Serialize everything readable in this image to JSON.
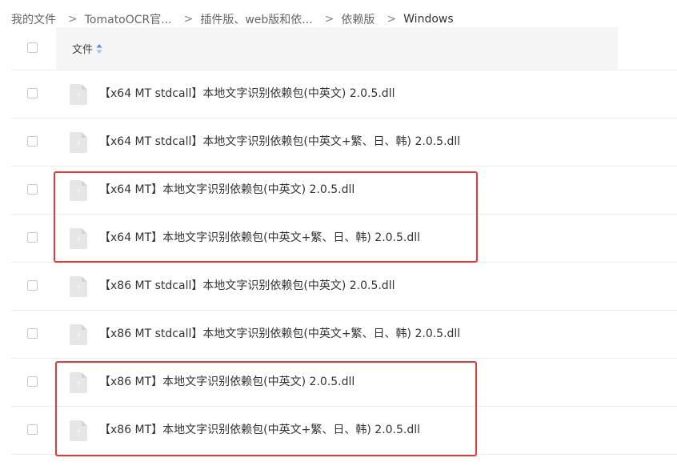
{
  "breadcrumb": {
    "items": [
      "我的文件",
      "TomatoOCR官...",
      "插件版、web版和依...",
      "依赖版",
      "Windows"
    ],
    "separator": ">"
  },
  "table": {
    "header_label": "文件",
    "files": [
      "【x64 MT stdcall】本地文字识别依赖包(中英文) 2.0.5.dll",
      "【x64 MT stdcall】本地文字识别依赖包(中英文+繁、日、韩) 2.0.5.dll",
      "【x64 MT】本地文字识别依赖包(中英文) 2.0.5.dll",
      "【x64 MT】本地文字识别依赖包(中英文+繁、日、韩) 2.0.5.dll",
      "【x86 MT stdcall】本地文字识别依赖包(中英文) 2.0.5.dll",
      "【x86 MT stdcall】本地文字识别依赖包(中英文+繁、日、韩) 2.0.5.dll",
      "【x86 MT】本地文字识别依赖包(中英文) 2.0.5.dll",
      "【x86 MT】本地文字识别依赖包(中英文+繁、日、韩) 2.0.5.dll"
    ]
  },
  "icons": {
    "sort": "sort-icon",
    "file": "unknown-file-icon"
  },
  "colors": {
    "highlight": "#e53935",
    "sort_accent": "#4a90e2",
    "header_bg": "#f5f5f5"
  }
}
